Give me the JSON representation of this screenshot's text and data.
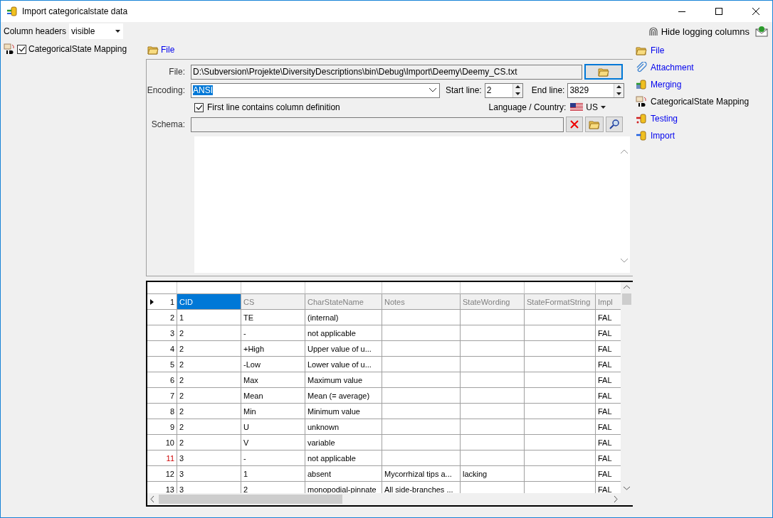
{
  "window": {
    "title": "Import categoricalstate data"
  },
  "toolbar": {
    "column_headers_label": "Column headers",
    "column_headers_value": "visible",
    "hide_logging_label": "Hide logging columns"
  },
  "tree": [
    {
      "label": "CategoricalState Mapping",
      "checked": true
    }
  ],
  "file_section": {
    "header": "File",
    "file_label": "File:",
    "file_path": "D:\\Subversion\\Projekte\\DiversityDescriptions\\bin\\Debug\\Import\\Deemy\\Deemy_CS.txt",
    "encoding_label": "Encoding:",
    "encoding": "ANSI",
    "start_line_label": "Start line:",
    "start_line": "2",
    "end_line_label": "End line:",
    "end_line": "3829",
    "first_line_label": "First line contains column definition",
    "first_line_checked": true,
    "language_label": "Language / Country:",
    "language": "US",
    "schema_label": "Schema:"
  },
  "grid": {
    "header_row": {
      "number": "1",
      "current": true,
      "cells": [
        {
          "text": "CID",
          "selected": true
        },
        {
          "text": "CS",
          "selected": false
        },
        {
          "text": "CharStateName",
          "selected": false
        },
        {
          "text": "Notes",
          "selected": false
        },
        {
          "text": "StateWording",
          "selected": false
        },
        {
          "text": "StateFormatString",
          "selected": false
        },
        {
          "text": "Impl",
          "selected": false
        }
      ]
    },
    "rows": [
      {
        "number": "2",
        "flagged": false,
        "cells": [
          "1",
          "TE",
          "(internal)",
          "",
          "",
          "",
          "FAL"
        ]
      },
      {
        "number": "3",
        "flagged": false,
        "cells": [
          "2",
          "-",
          "not applicable",
          "",
          "",
          "",
          "FAL"
        ]
      },
      {
        "number": "4",
        "flagged": false,
        "cells": [
          "2",
          "+High",
          "Upper value of u...",
          "",
          "",
          "",
          "FAL"
        ]
      },
      {
        "number": "5",
        "flagged": false,
        "cells": [
          "2",
          "-Low",
          "Lower value of u...",
          "",
          "",
          "",
          "FAL"
        ]
      },
      {
        "number": "6",
        "flagged": false,
        "cells": [
          "2",
          "Max",
          "Maximum value",
          "",
          "",
          "",
          "FAL"
        ]
      },
      {
        "number": "7",
        "flagged": false,
        "cells": [
          "2",
          "Mean",
          "Mean (= average)",
          "",
          "",
          "",
          "FAL"
        ]
      },
      {
        "number": "8",
        "flagged": false,
        "cells": [
          "2",
          "Min",
          "Minimum value",
          "",
          "",
          "",
          "FAL"
        ]
      },
      {
        "number": "9",
        "flagged": false,
        "cells": [
          "2",
          "U",
          "unknown",
          "",
          "",
          "",
          "FAL"
        ]
      },
      {
        "number": "10",
        "flagged": false,
        "cells": [
          "2",
          "V",
          "variable",
          "",
          "",
          "",
          "FAL"
        ]
      },
      {
        "number": "11",
        "flagged": true,
        "cells": [
          "3",
          "-",
          "not applicable",
          "",
          "",
          "",
          "FAL"
        ]
      },
      {
        "number": "12",
        "flagged": false,
        "cells": [
          "3",
          "1",
          "absent",
          "Mycorrhizal tips a...",
          "lacking",
          "",
          "FAL"
        ]
      },
      {
        "number": "13",
        "flagged": false,
        "cells": [
          "3",
          "2",
          "monopodial-pinnate",
          "All side-branches ...",
          "",
          "",
          "FAL"
        ]
      }
    ]
  },
  "steps": [
    {
      "kind": "file",
      "label": "File",
      "link": true
    },
    {
      "kind": "attachment",
      "label": "Attachment",
      "link": true
    },
    {
      "kind": "merging",
      "label": "Merging",
      "link": true
    },
    {
      "kind": "mapping",
      "label": "CategoricalState Mapping",
      "link": false
    },
    {
      "kind": "testing",
      "label": "Testing",
      "link": true
    },
    {
      "kind": "import",
      "label": "Import",
      "link": true
    }
  ]
}
